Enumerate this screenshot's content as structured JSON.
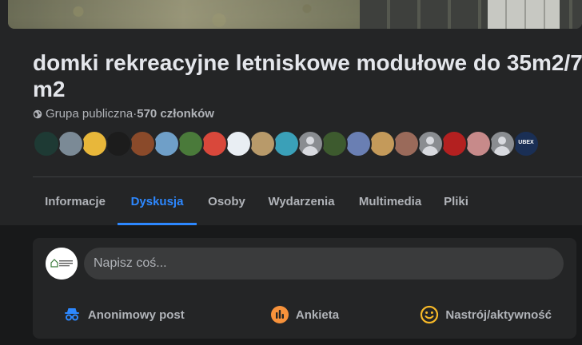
{
  "group": {
    "title": "domki rekreacyjne letniskowe modułowe do 35m2/7 m2",
    "privacy": "Grupa publiczna",
    "separator": " · ",
    "members": "570 członków"
  },
  "member_avatars": [
    {
      "name": "member-avatar-1",
      "color": "#1e3a34"
    },
    {
      "name": "member-avatar-2",
      "color": "#7b8a96"
    },
    {
      "name": "member-avatar-3",
      "color": "#e8b73a"
    },
    {
      "name": "member-avatar-4",
      "color": "#1c1c1c"
    },
    {
      "name": "member-avatar-5",
      "color": "#8a4a2a"
    },
    {
      "name": "member-avatar-6",
      "color": "#6f9fc8"
    },
    {
      "name": "member-avatar-7",
      "color": "#4a7a3a"
    },
    {
      "name": "member-avatar-8",
      "color": "#d9483b"
    },
    {
      "name": "member-avatar-9",
      "color": "#e9eef3"
    },
    {
      "name": "member-avatar-10",
      "color": "#b89a6a"
    },
    {
      "name": "member-avatar-11",
      "color": "#3aa0b8"
    },
    {
      "name": "member-avatar-12",
      "color": "placeholder"
    },
    {
      "name": "member-avatar-13",
      "color": "#3d5a2e"
    },
    {
      "name": "member-avatar-14",
      "color": "#6a7fb3"
    },
    {
      "name": "member-avatar-15",
      "color": "#c49a5a"
    },
    {
      "name": "member-avatar-16",
      "color": "#9a6a5a"
    },
    {
      "name": "member-avatar-17",
      "color": "placeholder"
    },
    {
      "name": "member-avatar-18",
      "color": "#b32020"
    },
    {
      "name": "member-avatar-19",
      "color": "#c78a8a"
    },
    {
      "name": "member-avatar-20",
      "color": "placeholder"
    },
    {
      "name": "member-avatar-21",
      "color": "#1a2f55",
      "text": "UBEX"
    }
  ],
  "tabs": [
    {
      "label": "Informacje",
      "active": false
    },
    {
      "label": "Dyskusja",
      "active": true
    },
    {
      "label": "Osoby",
      "active": false
    },
    {
      "label": "Wydarzenia",
      "active": false
    },
    {
      "label": "Multimedia",
      "active": false
    },
    {
      "label": "Pliki",
      "active": false
    }
  ],
  "composer": {
    "placeholder": "Napisz coś...",
    "page_avatar_text": "DOMKI MODUŁOWE DOMY MODUŁOWE",
    "actions": [
      {
        "label": "Anonimowy post",
        "icon": "anonymous-icon",
        "color": "#2d88ff"
      },
      {
        "label": "Ankieta",
        "icon": "poll-icon",
        "color": "#f7923b"
      },
      {
        "label": "Nastrój/aktywność",
        "icon": "smiley-icon",
        "color": "#f7b928"
      }
    ]
  },
  "colors": {
    "background": "#18191a",
    "panel": "#242526",
    "accent": "#2d88ff",
    "text_primary": "#e4e6eb",
    "text_secondary": "#b0b3b8"
  }
}
